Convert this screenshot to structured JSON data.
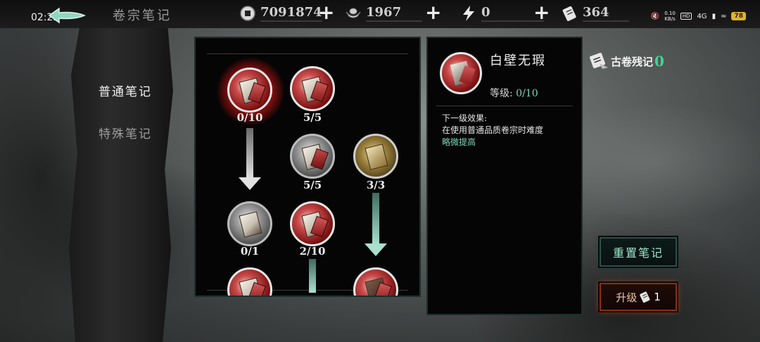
{
  "status_bar": {
    "time": "02:22",
    "net_speed": "0.10\nKB/s",
    "hd": "HD",
    "signal": "4G",
    "battery": "78"
  },
  "header": {
    "title": "卷宗笔记",
    "resources": [
      {
        "icon": "coin-icon",
        "value": "7091874"
      },
      {
        "icon": "silver-ingot-icon",
        "value": "1967"
      },
      {
        "icon": "lightning-icon",
        "value": "0"
      },
      {
        "icon": "scroll-ticket-icon",
        "value": "364"
      }
    ]
  },
  "sidebar": {
    "tabs": [
      {
        "label": "普通笔记",
        "active": true
      },
      {
        "label": "特殊笔记",
        "active": false
      }
    ]
  },
  "tree": {
    "nodes": [
      {
        "name": "baibi-wuxia",
        "style": "red",
        "count": "0/10",
        "selected": true
      },
      {
        "name": "node-top-2",
        "style": "red",
        "count": "5/5"
      },
      {
        "name": "node-mid-2",
        "style": "grey",
        "count": "5/5"
      },
      {
        "name": "node-mid-3",
        "style": "gold",
        "count": "3/3"
      },
      {
        "name": "node-low-1",
        "style": "grey",
        "count": "0/1"
      },
      {
        "name": "node-low-2",
        "style": "red",
        "count": "2/10"
      },
      {
        "name": "node-bottom-1",
        "style": "red",
        "count": ""
      },
      {
        "name": "node-bottom-3",
        "style": "red",
        "count": ""
      }
    ]
  },
  "detail": {
    "name": "白壁无瑕",
    "level_label": "等级:",
    "level_value": "0/10",
    "next_effect_label": "下一级效果:",
    "next_effect_text": "在使用普通品质卷宗时难度",
    "next_effect_highlight": "略微提高"
  },
  "fragments": {
    "label": "古卷残记",
    "count": "0"
  },
  "buttons": {
    "reset": "重置笔记",
    "upgrade": "升级",
    "upgrade_cost": "1"
  },
  "colors": {
    "accent_teal": "#7fd7b9",
    "accent_green": "#3bd69a",
    "active_tab_red": "#8b1414",
    "upgrade_border": "#8a2e14"
  }
}
